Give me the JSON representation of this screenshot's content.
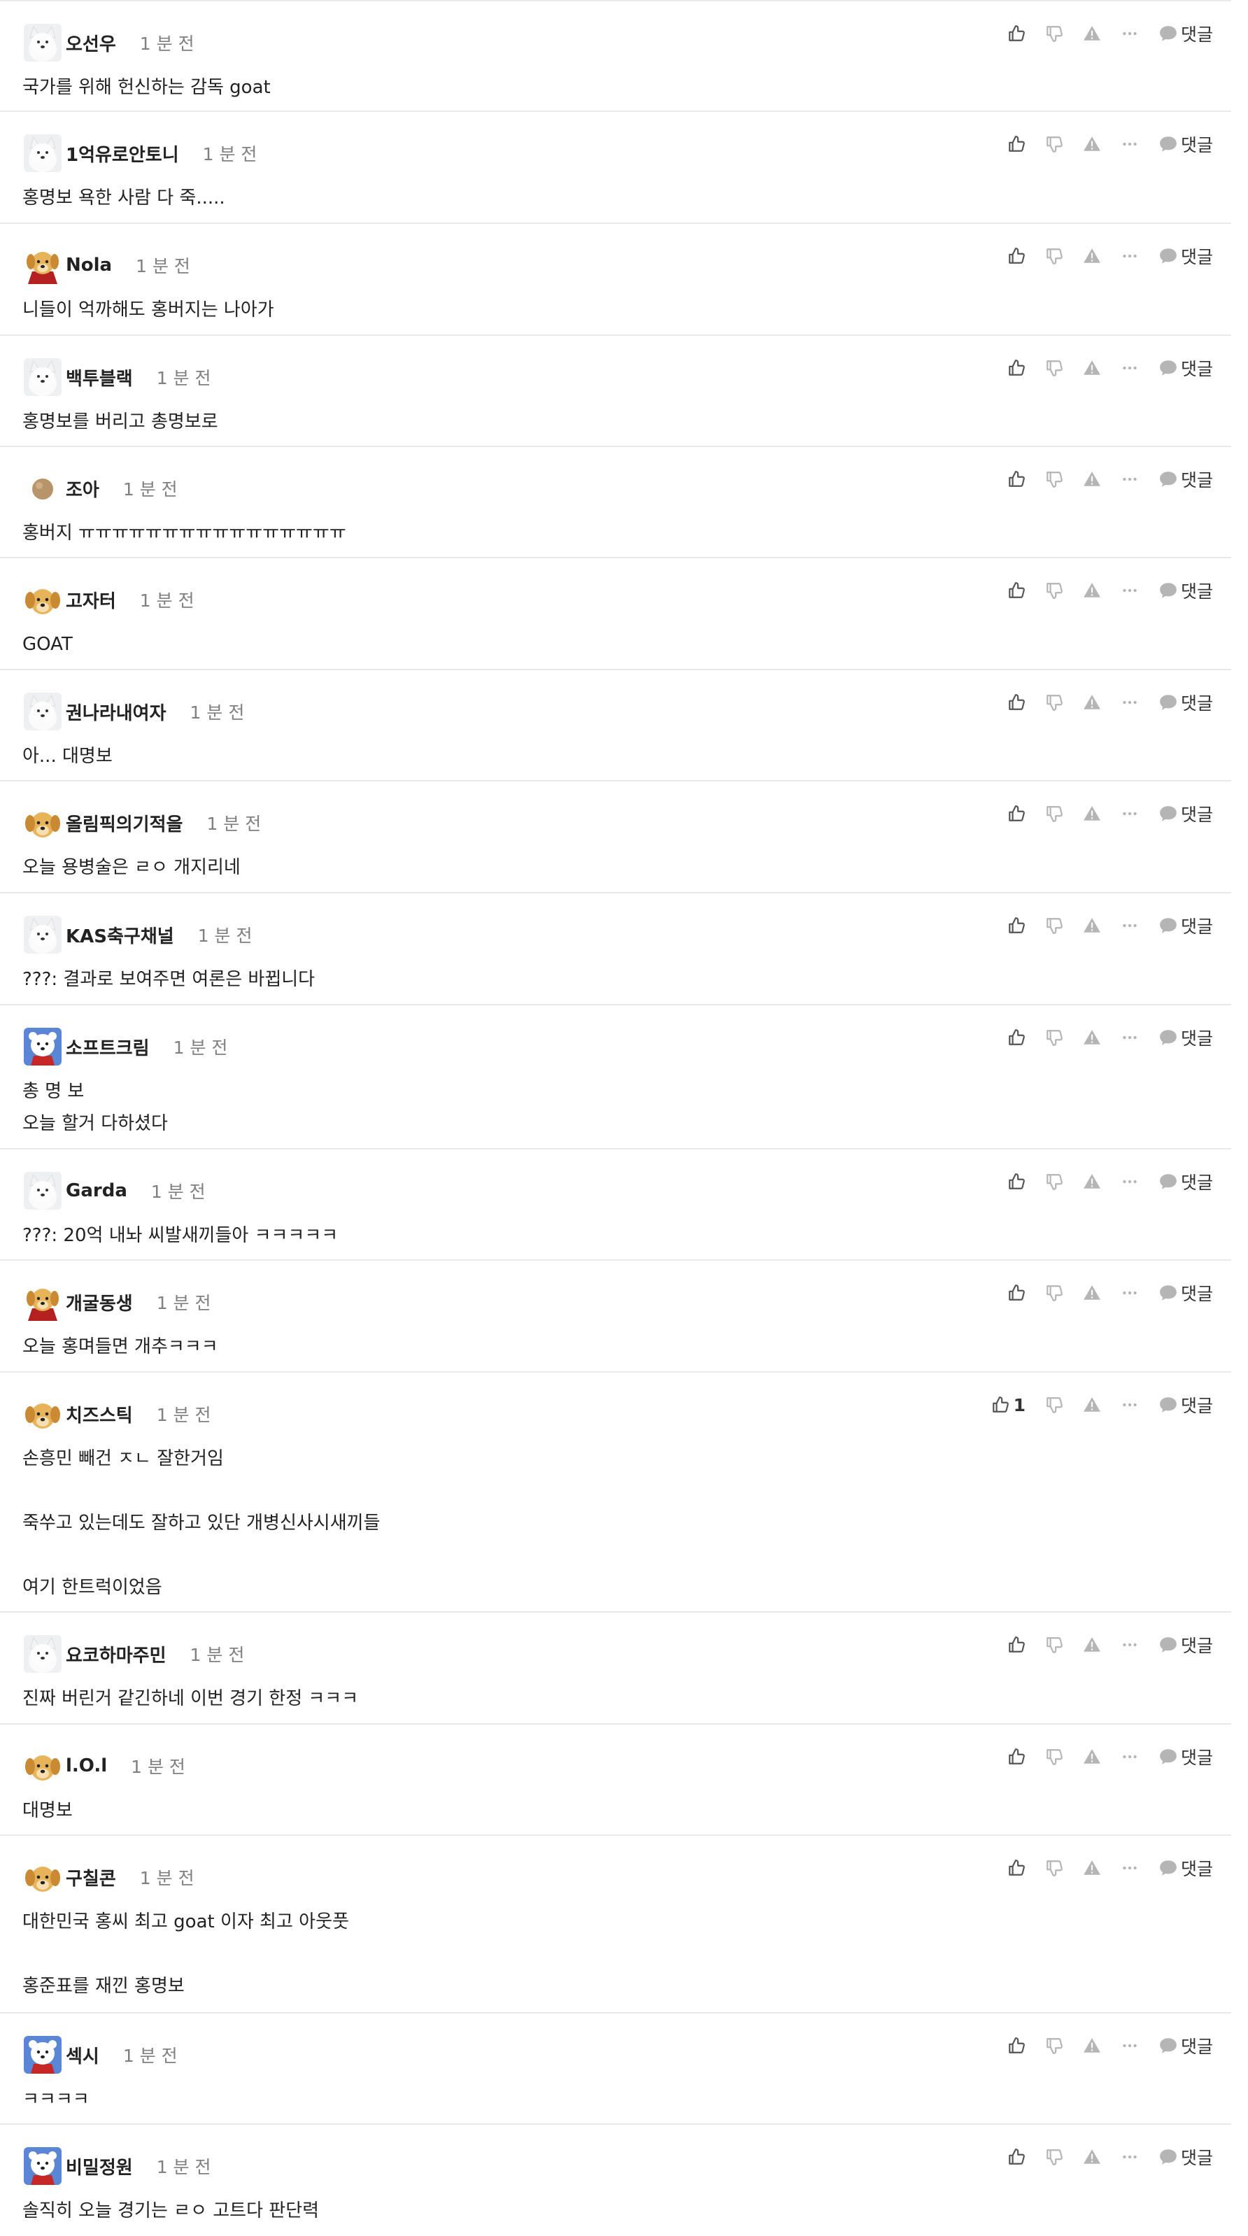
{
  "labels": {
    "reply": "댓글"
  },
  "colors": {
    "icon_dark": "#555555",
    "icon_light": "#b5b5b5",
    "divider": "#e9e9e9",
    "time_text": "#808080"
  },
  "comments": [
    {
      "nickname": "오선우",
      "time": "1 분 전",
      "text": "국가를 위해 헌신하는 감독 goat",
      "avatar": "white-dog-avatar",
      "likes": ""
    },
    {
      "nickname": "1억유로안토니",
      "time": "1 분 전",
      "text": "홍명보 욕한 사람 다 죽.....",
      "avatar": "white-dog-avatar",
      "likes": ""
    },
    {
      "nickname": "Nola",
      "time": "1 분 전",
      "text": "니들이 억까해도 홍버지는 나아가",
      "avatar": "puppy-cape-avatar",
      "likes": ""
    },
    {
      "nickname": "백투블랙",
      "time": "1 분 전",
      "text": "홍명보를 버리고 총명보로",
      "avatar": "white-dog-avatar",
      "likes": ""
    },
    {
      "nickname": "조아",
      "time": "1 분 전",
      "text": "홍버지 ㅠㅠㅠㅠㅠㅠㅠㅠㅠㅠㅠㅠㅠㅠㅠㅠ",
      "avatar": "ball-avatar",
      "likes": ""
    },
    {
      "nickname": "고자터",
      "time": "1 분 전",
      "text": "GOAT",
      "avatar": "puppy-avatar",
      "likes": ""
    },
    {
      "nickname": "권나라내여자",
      "time": "1 분 전",
      "text": "아... 대명보",
      "avatar": "white-dog-avatar",
      "likes": ""
    },
    {
      "nickname": "올림픽의기적을",
      "time": "1 분 전",
      "text": "오늘 용병술은 ㄹㅇ 개지리네",
      "avatar": "puppy-avatar",
      "likes": ""
    },
    {
      "nickname": "KAS축구채널",
      "time": "1 분 전",
      "text": "???: 결과로 보여주면 여론은 바뀝니다",
      "avatar": "white-dog-avatar",
      "likes": ""
    },
    {
      "nickname": "소프트크림",
      "time": "1 분 전",
      "text": "총 명 보\n오늘 할거 다하셨다",
      "avatar": "bear-avatar",
      "likes": ""
    },
    {
      "nickname": "Garda",
      "time": "1 분 전",
      "text": "???: 20억 내놔 씨발새끼들아 ㅋㅋㅋㅋㅋ",
      "avatar": "white-dog-avatar",
      "likes": ""
    },
    {
      "nickname": "개굴동생",
      "time": "1 분 전",
      "text": "오늘 홍며들면 개추ㅋㅋㅋ",
      "avatar": "puppy-cape-avatar",
      "likes": ""
    },
    {
      "nickname": "치즈스틱",
      "time": "1 분 전",
      "text": "손흥민 빼건 ㅈㄴ 잘한거임\n\n죽쑤고 있는데도 잘하고 있단 개병신사시새끼들\n\n여기 한트럭이었음",
      "avatar": "puppy-avatar",
      "likes": "1"
    },
    {
      "nickname": "요코하마주민",
      "time": "1 분 전",
      "text": "진짜 버린거 같긴하네 이번 경기 한정 ㅋㅋㅋ",
      "avatar": "white-dog-avatar",
      "likes": ""
    },
    {
      "nickname": "l.O.l",
      "time": "1 분 전",
      "text": "대명보",
      "avatar": "puppy-avatar",
      "likes": ""
    },
    {
      "nickname": "구칠콘",
      "time": "1 분 전",
      "text": "대한민국 홍씨 최고 goat 이자 최고 아웃풋\n\n홍준표를 재낀 홍명보",
      "avatar": "puppy-avatar",
      "likes": ""
    },
    {
      "nickname": "섹시",
      "time": "1 분 전",
      "text": "ㅋㅋㅋㅋ",
      "avatar": "bear-avatar",
      "likes": ""
    },
    {
      "nickname": "비밀정원",
      "time": "1 분 전",
      "text": "솔직히 오늘 경기는 ㄹㅇ 고트다 판단력",
      "avatar": "bear-avatar",
      "likes": ""
    }
  ]
}
